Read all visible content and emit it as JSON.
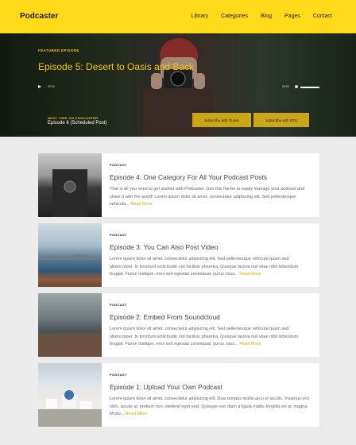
{
  "brand": {
    "name": "Podcaster"
  },
  "nav": {
    "items": [
      "Library",
      "Categories",
      "Blog",
      "Pages",
      "Contact"
    ]
  },
  "hero": {
    "featured_label": "FEATURED EPISODE",
    "title": "Episode 5: Desert to Oasis and Back",
    "player": {
      "current_time": "00:00",
      "duration": "00:00"
    },
    "next_label": "NEXT TIME ON PODCASTER",
    "next_title": "Episode 6 (Scheduled Post)",
    "buttons": {
      "itunes": "Subscribe with iTunes",
      "rss": "Subscribe with RSS"
    }
  },
  "posts": [
    {
      "category": "PODCAST",
      "title": "Episode 4: One Category For All Your Podcast Posts",
      "excerpt": "That is all you need to get started with Podcaster. Use this theme to easily manage your podcast and share it with the world! Lorem ipsum dolor sit amet, consectetur adipiscing elit. Sed pellentesque vehicula",
      "read_more": "Read More"
    },
    {
      "category": "PODCAST",
      "title": "Episode 3: You Can Also Post Video",
      "excerpt": "Lorem ipsum dolor sit amet, consectetur adipiscing elit. Sed pellentesque vehicula quam sed ullamcorper. In tincidunt sollicitudin nisl facilisis pharetra. Quisque lacinia nisl vitae nibh bibendum feugiat. Fusce tristique, eros sed egestas consequat, purus risus",
      "read_more": "Read More"
    },
    {
      "category": "PODCAST",
      "title": "Episode 2: Embed From Soundcloud",
      "excerpt": "Lorem ipsum dolor sit amet, consectetur adipiscing elit. Sed pellentesque vehicula quam sed ullamcorper. In tincidunt sollicitudin nisl facilisis pharetra. Quisque lacinia nisl vitae nibh bibendum feugiat. Fusce tristique, eros sed egestas consequat, purus risus",
      "read_more": "Read More"
    },
    {
      "category": "PODCAST",
      "title": "Episode 1: Upload Your Own Podcast",
      "excerpt": "Lorem ipsum dolor sit amet, consectetur adipiscing elit. Duis tempus mollis arcu et iaculis. Vivamus orci nibh, iaculis ac pretium non, eleifend eget erat. Quisque non diam a ligula mattis fringilla vel ac magna. Morbi",
      "read_more": "Read More"
    }
  ],
  "colors": {
    "accent": "#ffda1a",
    "accent_text": "#f5c400",
    "button": "#c9a61a",
    "link": "#d4a900"
  }
}
